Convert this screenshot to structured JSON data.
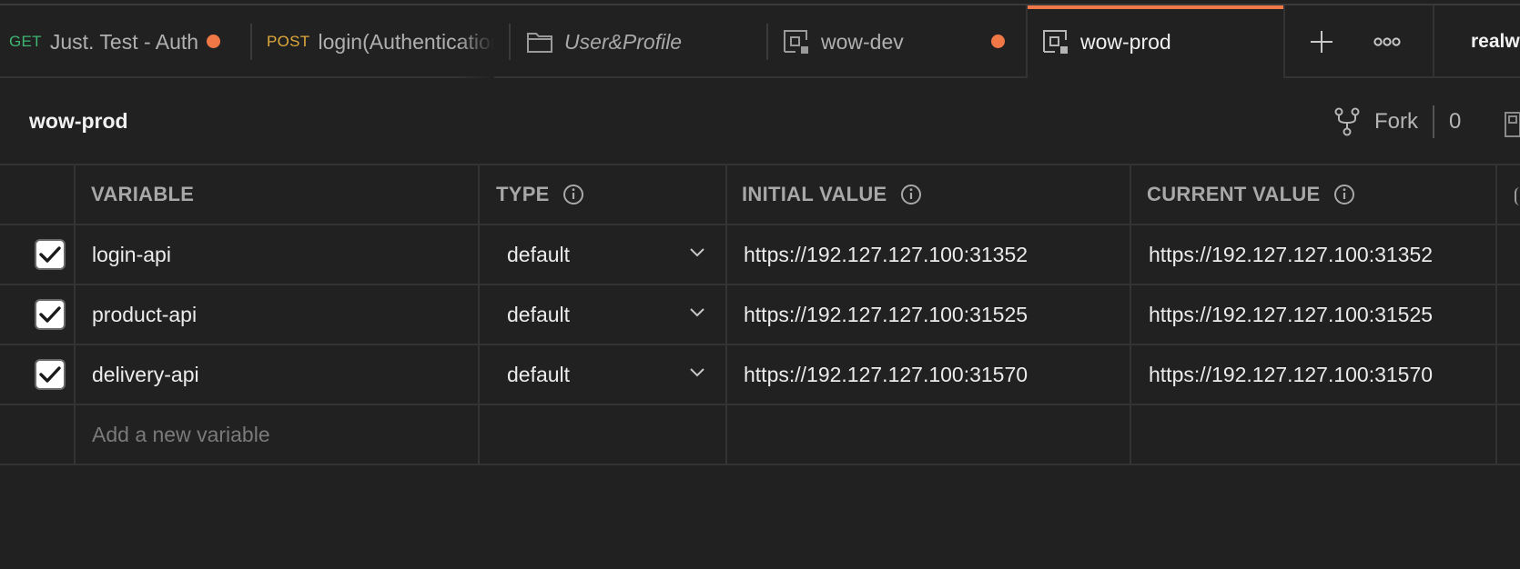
{
  "tabs": [
    {
      "method": "GET",
      "label": "Just. Test - Auth",
      "unsaved": true
    },
    {
      "method": "POST",
      "label": "login(Authentication",
      "unsaved": false
    },
    {
      "icon": "folder-icon",
      "label": "User&Profile",
      "unsaved": false
    },
    {
      "icon": "environment-icon",
      "label": "wow-dev",
      "unsaved": true
    },
    {
      "icon": "environment-icon",
      "label": "wow-prod",
      "unsaved": false,
      "active": true
    }
  ],
  "workspace_label": "realw",
  "header": {
    "title": "wow-prod",
    "fork_label": "Fork",
    "fork_count": "0"
  },
  "columns": {
    "variable": "VARIABLE",
    "type": "TYPE",
    "initial_value": "INITIAL VALUE",
    "current_value": "CURRENT VALUE"
  },
  "rows": [
    {
      "checked": true,
      "variable": "login-api",
      "type": "default",
      "initial": "https://192.127.127.100:31352",
      "current": "https://192.127.127.100:31352"
    },
    {
      "checked": true,
      "variable": "product-api",
      "type": "default",
      "initial": "https://192.127.127.100:31525",
      "current": "https://192.127.127.100:31525"
    },
    {
      "checked": true,
      "variable": "delivery-api",
      "type": "default",
      "initial": "https://192.127.127.100:31570",
      "current": "https://192.127.127.100:31570"
    }
  ],
  "new_variable_placeholder": "Add a new variable",
  "colors": {
    "background": "#212121",
    "accent": "#f07847",
    "get_method": "#3eb572",
    "post_method": "#e0a93b"
  }
}
